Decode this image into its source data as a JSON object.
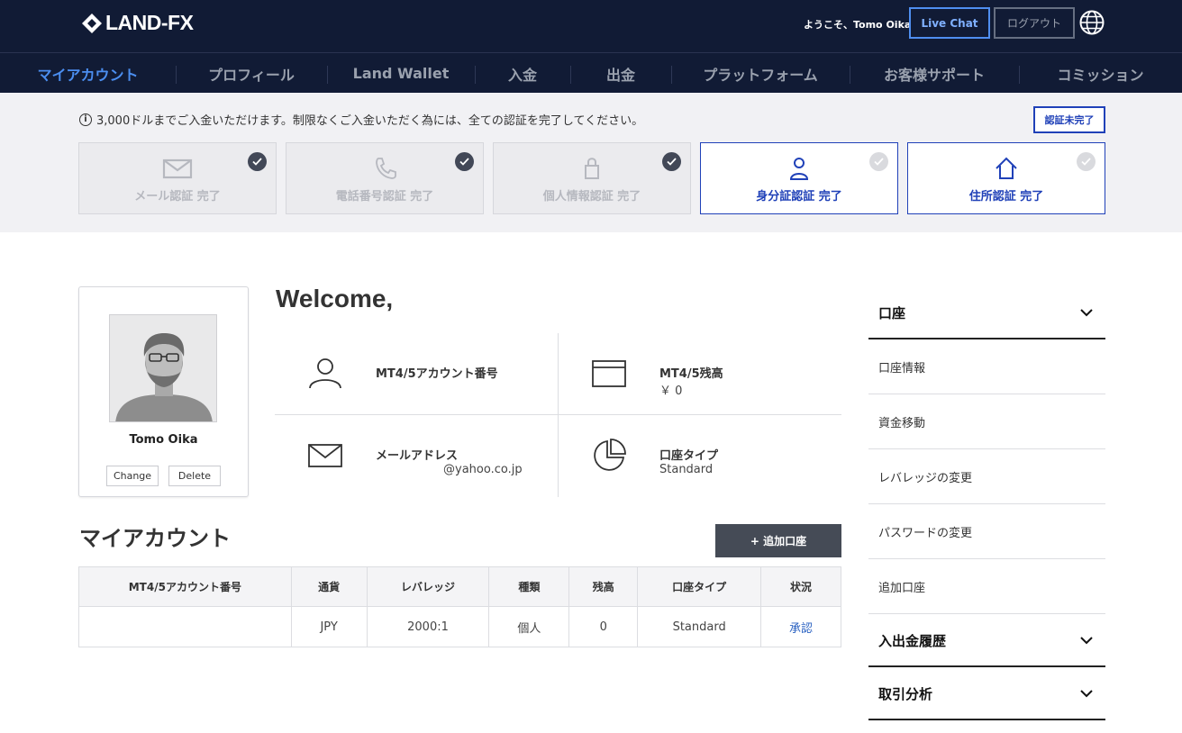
{
  "header": {
    "logo_text": "LAND-FX",
    "welcome": "ようこそ、Tomo Oika",
    "live_chat": "Live Chat",
    "logout": "ログアウト",
    "language_icon": "globe-icon"
  },
  "nav": {
    "items": [
      "マイアカウント",
      "プロフィール",
      "Land Wallet",
      "入金",
      "出金",
      "プラットフォーム",
      "お客様サポート",
      "コミッション"
    ],
    "active_index": 0
  },
  "verification": {
    "notice": "3,000ドルまでご入金いただけます。制限なくご入金いただく為には、全ての認証を完了してください。",
    "status_button": "認証未完了",
    "cards": [
      {
        "label": "メール認証 完了",
        "icon": "mail-icon",
        "done": true
      },
      {
        "label": "電話番号認証 完了",
        "icon": "phone-icon",
        "done": true
      },
      {
        "label": "個人情報認証 完了",
        "icon": "lock-icon",
        "done": true
      },
      {
        "label": "身分証認証 完了",
        "icon": "user-icon",
        "done": false
      },
      {
        "label": "住所認証 完了",
        "icon": "home-icon",
        "done": false
      }
    ]
  },
  "profile": {
    "name": "Tomo Oika",
    "change": "Change",
    "delete": "Delete"
  },
  "welcome": {
    "title": "Welcome,",
    "account_number_label": "MT4/5アカウント番号",
    "account_number_value": "",
    "balance_label": "MT4/5残高",
    "balance_value": "￥ 0",
    "email_label": "メールアドレス",
    "email_value": "@yahoo.co.jp",
    "account_type_label": "口座タイプ",
    "account_type_value": "Standard"
  },
  "my_account": {
    "title": "マイアカウント",
    "add_button": "+ 追加口座",
    "columns": [
      "MT4/5アカウント番号",
      "通貨",
      "レバレッジ",
      "種類",
      "残高",
      "口座タイプ",
      "状況"
    ],
    "rows": [
      [
        "",
        "JPY",
        "2000:1",
        "個人",
        "0",
        "Standard",
        "承認"
      ]
    ]
  },
  "sidebar": {
    "group1": "口座",
    "items": [
      "口座情報",
      "資金移動",
      "レバレッジの変更",
      "パスワードの変更",
      "追加口座"
    ],
    "group2": "入出金履歴",
    "group3": "取引分析"
  }
}
